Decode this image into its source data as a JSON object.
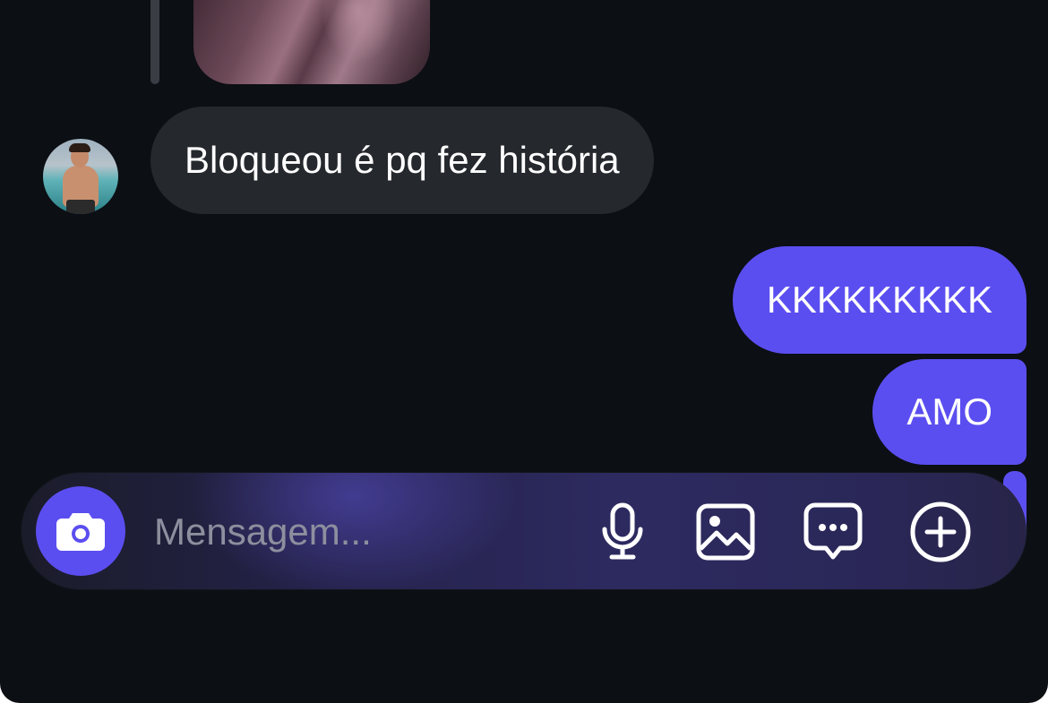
{
  "conversation": {
    "incoming": [
      {
        "text": "Bloqueou é pq fez história"
      }
    ],
    "outgoing": [
      {
        "text": "KKKKKKKKK"
      },
      {
        "text": "AMO"
      }
    ]
  },
  "composer": {
    "placeholder": "Mensagem...",
    "value": "",
    "icons": {
      "camera": "camera-icon",
      "mic": "microphone-icon",
      "gallery": "image-icon",
      "sticker": "chat-bubble-icon",
      "more": "plus-circle-icon"
    }
  },
  "colors": {
    "background": "#0c0f14",
    "incoming_bubble": "#25282d",
    "outgoing_bubble": "#5b4ef0",
    "accent": "#5b4ef0",
    "placeholder": "#8d8f9e"
  }
}
